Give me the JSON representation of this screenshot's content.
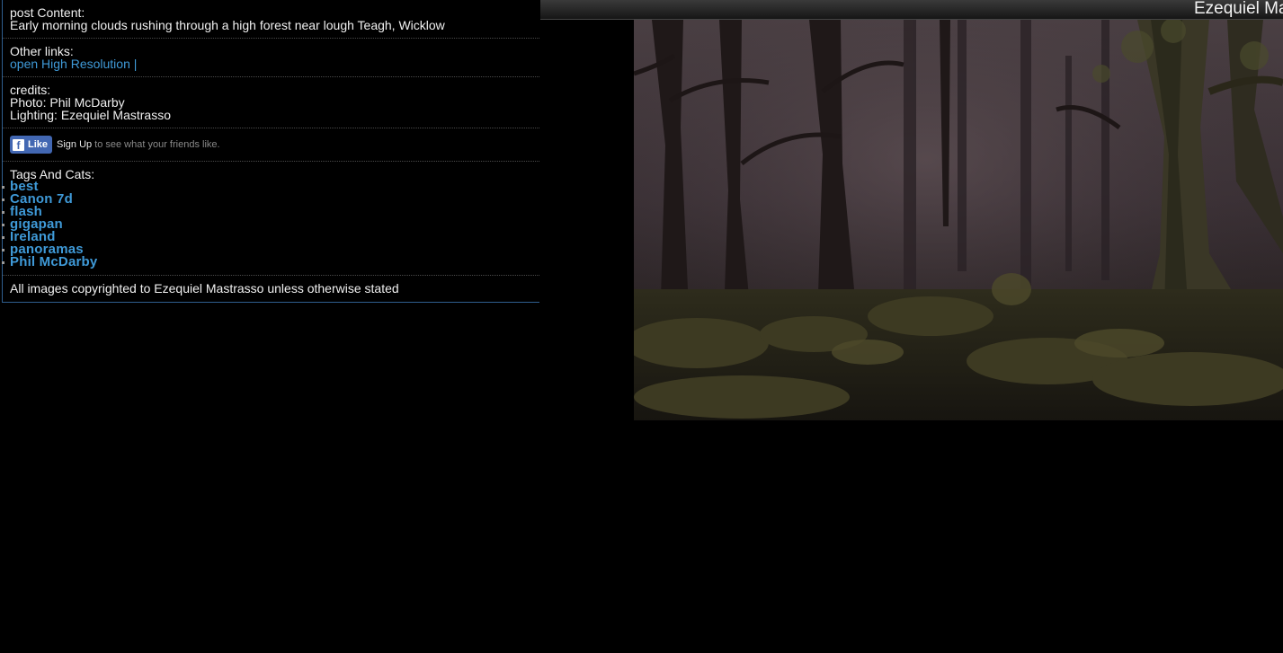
{
  "post": {
    "content_label": "post Content:",
    "content_text": "Early morning clouds rushing through a high forest near lough Teagh, Wicklow"
  },
  "links": {
    "label": "Other links:",
    "high_res": "open High Resolution |"
  },
  "credits": {
    "label": "credits:",
    "photo": "Photo: Phil McDarby",
    "lighting": "Lighting: Ezequiel Mastrasso"
  },
  "facebook": {
    "icon": "facebook-f-icon",
    "like_label": "Like",
    "signup_label": "Sign Up",
    "signup_rest": "to see what your friends like.",
    "brand_color": "#4267b2"
  },
  "tags": {
    "label": "Tags And Cats:",
    "items": [
      "best",
      "Canon 7d",
      "flash",
      "gigapan",
      "Ireland",
      "panoramas",
      "Phil McDarby"
    ]
  },
  "footer": {
    "copyright": "All images copyrighted to Ezequiel Mastrasso unless otherwise stated"
  },
  "header": {
    "site_title": "Ezequiel Ma"
  },
  "photo": {
    "description_icon": "forest-photo"
  },
  "colors": {
    "background": "#000000",
    "link": "#3f9ad8",
    "panel_border": "#2f5f8f"
  }
}
